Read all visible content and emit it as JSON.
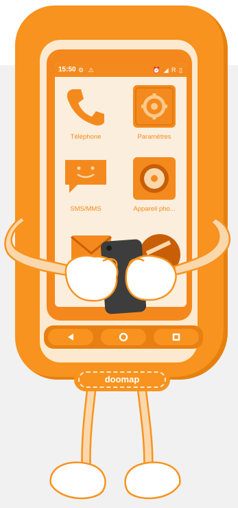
{
  "status_bar": {
    "time": "15:50",
    "left_icons": "⚙ ⚠",
    "right_icons": "⏰ ◢ R ▯"
  },
  "apps": [
    {
      "label": "Téléphone",
      "icon": "phone-icon"
    },
    {
      "label": "Paramètres",
      "icon": "gear-icon"
    },
    {
      "label": "SMS/MMS",
      "icon": "message-icon"
    },
    {
      "label": "Appareil pho...",
      "icon": "camera-icon"
    }
  ],
  "nav": {
    "back": "back-icon",
    "home": "home-icon",
    "recents": "recents-icon"
  },
  "brand": {
    "name": "doomap"
  },
  "colors": {
    "orange": "#f7931e",
    "cream": "#fbeedd",
    "dark_orange": "#e87f12",
    "handset": "#3d3d3d"
  }
}
